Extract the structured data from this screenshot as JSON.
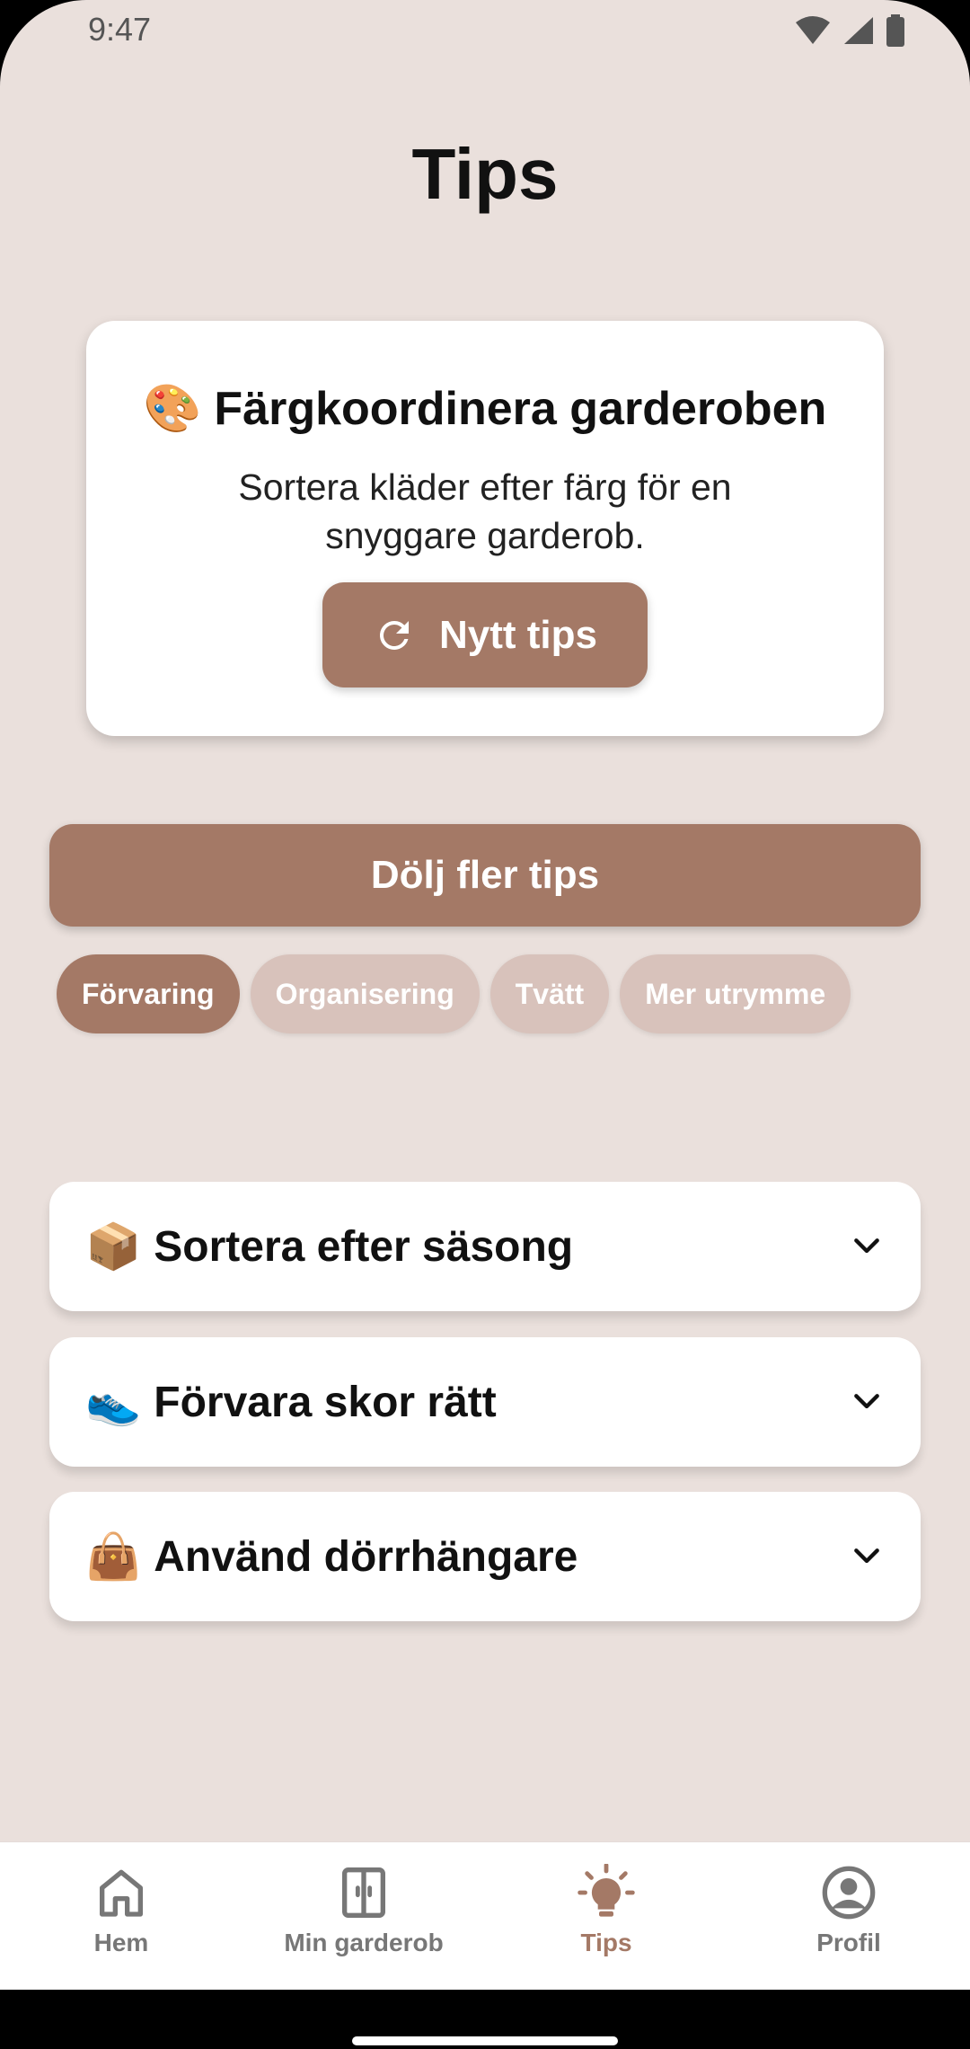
{
  "status_bar": {
    "time": "9:47"
  },
  "page": {
    "title": "Tips"
  },
  "tip_card": {
    "emoji": "🎨",
    "title": "Färgkoordinera garderoben",
    "text": "Sortera kläder efter färg för en snyggare garderob.",
    "button_label": "Nytt tips"
  },
  "hide_button_label": "Dölj fler tips",
  "categories": [
    {
      "label": "Förvaring",
      "active": true
    },
    {
      "label": "Organisering",
      "active": false
    },
    {
      "label": "Tvätt",
      "active": false
    },
    {
      "label": "Mer utrymme",
      "active": false
    }
  ],
  "tips_list": [
    {
      "emoji": "📦",
      "title": "Sortera efter säsong"
    },
    {
      "emoji": "👟",
      "title": "Förvara skor rätt"
    },
    {
      "emoji": "👜",
      "title": "Använd dörrhängare"
    }
  ],
  "bottom_nav": [
    {
      "label": "Hem",
      "icon": "home-icon",
      "active": false
    },
    {
      "label": "Min garderob",
      "icon": "wardrobe-icon",
      "active": false
    },
    {
      "label": "Tips",
      "icon": "lightbulb-icon",
      "active": true
    },
    {
      "label": "Profil",
      "icon": "profile-icon",
      "active": false
    }
  ],
  "colors": {
    "accent": "#a47966",
    "chip_inactive": "#d8c2bb",
    "background": "#eae0dc"
  }
}
